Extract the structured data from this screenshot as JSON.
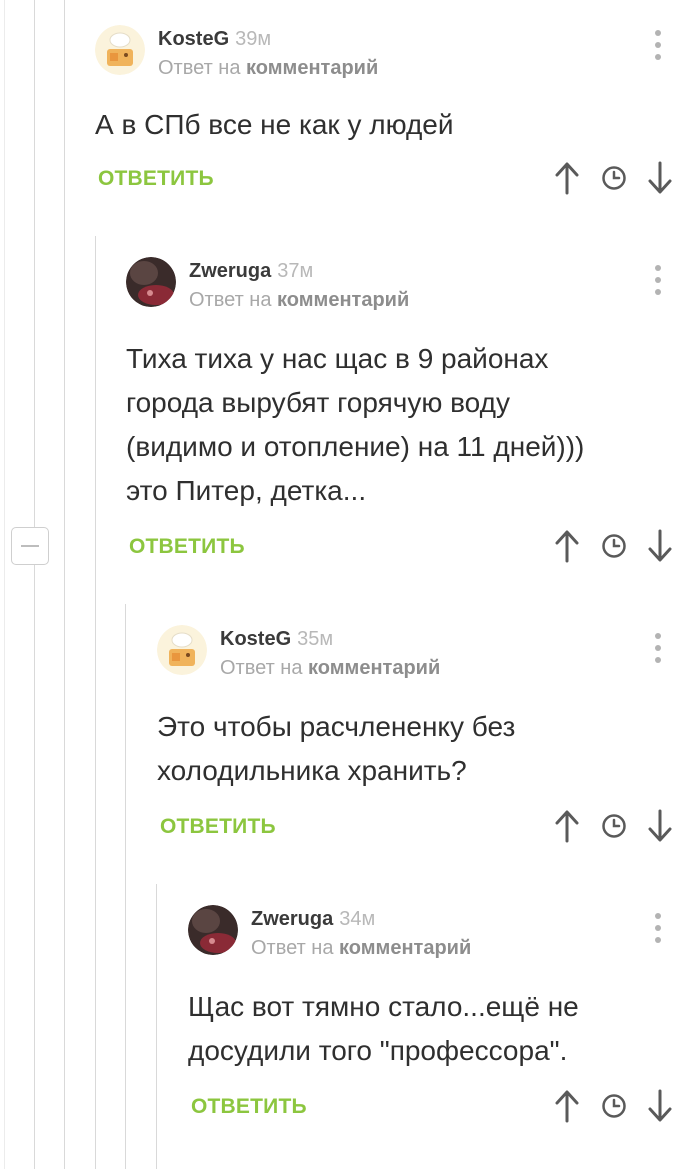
{
  "comments": [
    {
      "author": "KosteG",
      "time": "39м",
      "reply_prefix": "Ответ на",
      "reply_target": "комментарий",
      "text_lines": [
        "А в СПб все не как у людей"
      ],
      "reply_label": "ОТВЕТИТЬ"
    },
    {
      "author": "Zweruga",
      "time": "37м",
      "reply_prefix": "Ответ на",
      "reply_target": "комментарий",
      "text_lines": [
        "Тиха тиха у нас щас в 9 районах",
        "города вырубят горячую воду",
        "(видимо и отопление) на 11 дней)))",
        "это Питер, детка..."
      ],
      "reply_label": "ОТВЕТИТЬ"
    },
    {
      "author": "KosteG",
      "time": "35м",
      "reply_prefix": "Ответ на",
      "reply_target": "комментарий",
      "text_lines": [
        "Это чтобы расчлененку без",
        "холодильника хранить?"
      ],
      "reply_label": "ОТВЕТИТЬ"
    },
    {
      "author": "Zweruga",
      "time": "34м",
      "reply_prefix": "Ответ на",
      "reply_target": "комментарий",
      "text_lines": [
        "Щас вот тямно стало...ещё не",
        "досудили того \"профессора\"."
      ],
      "reply_label": "ОТВЕТИТЬ"
    }
  ],
  "icons": {
    "up": "arrow-up-icon",
    "time": "clock-icon",
    "down": "arrow-down-icon",
    "menu": "more-vertical-icon",
    "collapse": "minus-icon"
  },
  "colors": {
    "reply_green": "#8cc63f",
    "thread_line": "#d9d9d9",
    "muted_text": "#a8a8a8"
  }
}
